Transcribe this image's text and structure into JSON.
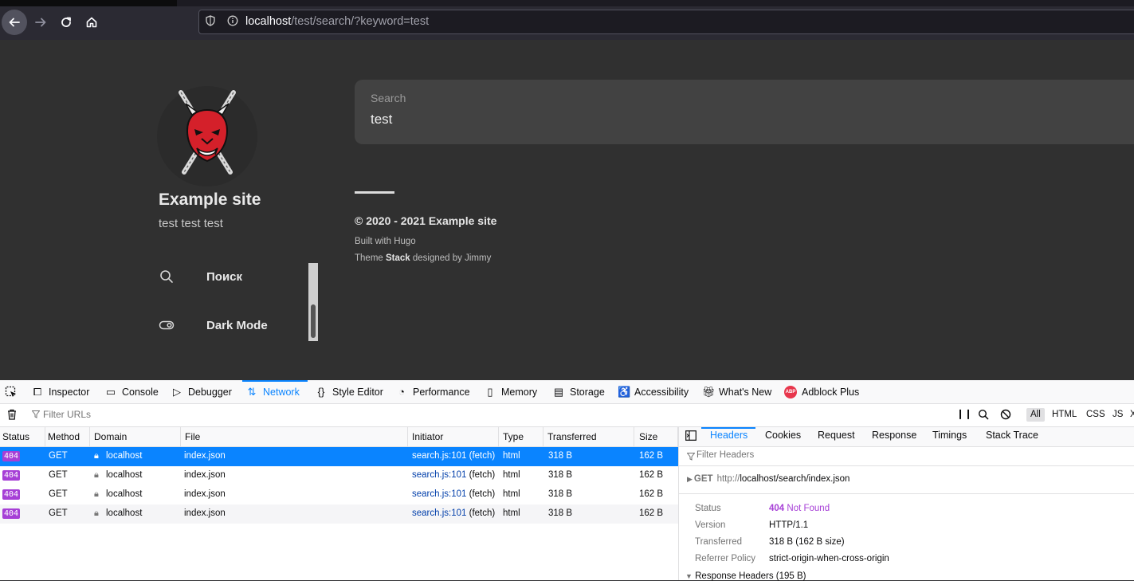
{
  "browser": {
    "url_host": "localhost",
    "url_path": "/test/search/?keyword=test"
  },
  "sidebar": {
    "site_title": "Example site",
    "site_description": "test test test",
    "menu": [
      {
        "label": "Поиск",
        "icon": "search-icon"
      },
      {
        "label": "Dark Mode",
        "icon": "toggle-icon"
      }
    ]
  },
  "search": {
    "label": "Search",
    "value": "test"
  },
  "footer": {
    "copyright": "© 2020 - 2021 Example site",
    "built_with": "Built with Hugo",
    "theme_prefix": "Theme",
    "theme_name": "Stack",
    "theme_suffix": "designed by Jimmy"
  },
  "devtools": {
    "tabs": [
      "Inspector",
      "Console",
      "Debugger",
      "Network",
      "Style Editor",
      "Performance",
      "Memory",
      "Storage",
      "Accessibility",
      "What's New",
      "Adblock Plus"
    ],
    "active_tab": "Network",
    "abp_badge": "ABP",
    "filter_placeholder": "Filter URLs",
    "type_filters": [
      "All",
      "HTML",
      "CSS",
      "JS"
    ],
    "active_type": "All",
    "columns": [
      "Status",
      "Method",
      "Domain",
      "File",
      "Initiator",
      "Type",
      "Transferred",
      "Size"
    ],
    "requests": [
      {
        "status": "404",
        "method": "GET",
        "domain": "localhost",
        "file": "index.json",
        "initiator_file": "search.js:101",
        "initiator_kind": "(fetch)",
        "type": "html",
        "transferred": "318 B",
        "size": "162 B"
      },
      {
        "status": "404",
        "method": "GET",
        "domain": "localhost",
        "file": "index.json",
        "initiator_file": "search.js:101",
        "initiator_kind": "(fetch)",
        "type": "html",
        "transferred": "318 B",
        "size": "162 B"
      },
      {
        "status": "404",
        "method": "GET",
        "domain": "localhost",
        "file": "index.json",
        "initiator_file": "search.js:101",
        "initiator_kind": "(fetch)",
        "type": "html",
        "transferred": "318 B",
        "size": "162 B"
      },
      {
        "status": "404",
        "method": "GET",
        "domain": "localhost",
        "file": "index.json",
        "initiator_file": "search.js:101",
        "initiator_kind": "(fetch)",
        "type": "html",
        "transferred": "318 B",
        "size": "162 B"
      }
    ],
    "detail_tabs": [
      "Headers",
      "Cookies",
      "Request",
      "Response",
      "Timings",
      "Stack Trace"
    ],
    "active_detail_tab": "Headers",
    "filter_headers_placeholder": "Filter Headers",
    "request_method": "GET",
    "request_url_prefix": "http://",
    "request_url_rest": "localhost/search/index.json",
    "status_label": "Status",
    "status_code": "404",
    "status_text": "Not Found",
    "version_label": "Version",
    "version_value": "HTTP/1.1",
    "transferred_label": "Transferred",
    "transferred_value": "318 B (162 B size)",
    "referrer_label": "Referrer Policy",
    "referrer_value": "strict-origin-when-cross-origin",
    "response_headers": "Response Headers (195 B)"
  },
  "colors": {
    "accent": "#0a84ff",
    "status_404": "#a63fd6"
  }
}
